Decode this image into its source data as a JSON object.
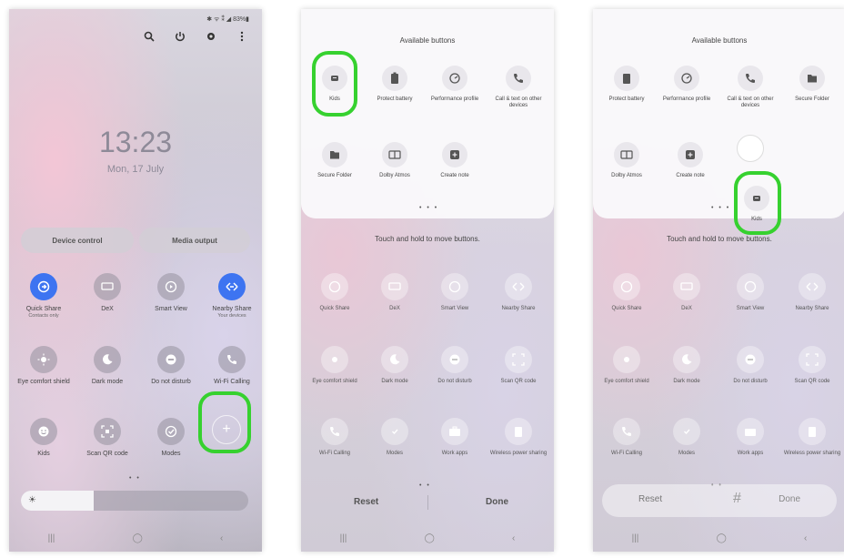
{
  "panel1": {
    "status_text": "✱ ᯤ ⁑ ◢ 83%▮",
    "clock": "13:23",
    "date": "Mon, 17 July",
    "pills": [
      "Device control",
      "Media output"
    ],
    "tiles_row1": [
      {
        "label": "Quick Share",
        "sub": "Contacts only",
        "active": true
      },
      {
        "label": "DeX",
        "sub": "",
        "active": false
      },
      {
        "label": "Smart View",
        "sub": "",
        "active": false
      },
      {
        "label": "Nearby Share",
        "sub": "Your devices",
        "active": true
      }
    ],
    "tiles_row2": [
      {
        "label": "Eye comfort shield"
      },
      {
        "label": "Dark mode"
      },
      {
        "label": "Do not disturb"
      },
      {
        "label": "Wi-Fi Calling"
      }
    ],
    "tiles_row3": [
      {
        "label": "Kids"
      },
      {
        "label": "Scan QR code"
      },
      {
        "label": "Modes"
      }
    ],
    "page_dots": "• •",
    "nav": [
      "|||",
      "◯",
      "‹"
    ]
  },
  "panel2": {
    "sheet_title": "Available buttons",
    "available_row1": [
      "Kids",
      "Protect battery",
      "Performance profile",
      "Call & text on other devices"
    ],
    "available_row2": [
      "Secure Folder",
      "Dolby Atmos",
      "Create note"
    ],
    "sheet_dots": "• • •",
    "hint": "Touch and hold to move buttons.",
    "active_row1": [
      "Quick Share",
      "DeX",
      "Smart View",
      "Nearby Share"
    ],
    "active_row2": [
      "Eye comfort shield",
      "Dark mode",
      "Do not disturb",
      "Scan QR code"
    ],
    "active_row3": [
      "Wi-Fi Calling",
      "Modes",
      "Work apps",
      "Wireless power sharing"
    ],
    "page_dots": "• •",
    "reset": "Reset",
    "done": "Done",
    "nav": [
      "|||",
      "◯",
      "‹"
    ]
  },
  "panel3": {
    "sheet_title": "Available buttons",
    "available_row1": [
      "Protect battery",
      "Performance profile",
      "Call & text on other devices",
      "Secure Folder"
    ],
    "available_row2": [
      "Dolby Atmos",
      "Create note"
    ],
    "dragging_label": "Kids",
    "sheet_dots": "• • •",
    "hint": "Touch and hold to move buttons.",
    "active_row1": [
      "Quick Share",
      "DeX",
      "Smart View",
      "Nearby Share"
    ],
    "active_row2": [
      "Eye comfort shield",
      "Dark mode",
      "Do not disturb",
      "Scan QR code"
    ],
    "active_row3": [
      "Wi-Fi Calling",
      "Modes",
      "Work apps",
      "Wireless power sharing"
    ],
    "page_dots": "• •",
    "reset": "Reset",
    "hash": "#",
    "done": "Done",
    "nav": [
      "|||",
      "◯",
      "‹"
    ]
  },
  "colors": {
    "highlight": "#36d12f",
    "active_tile": "#3d74f1"
  }
}
